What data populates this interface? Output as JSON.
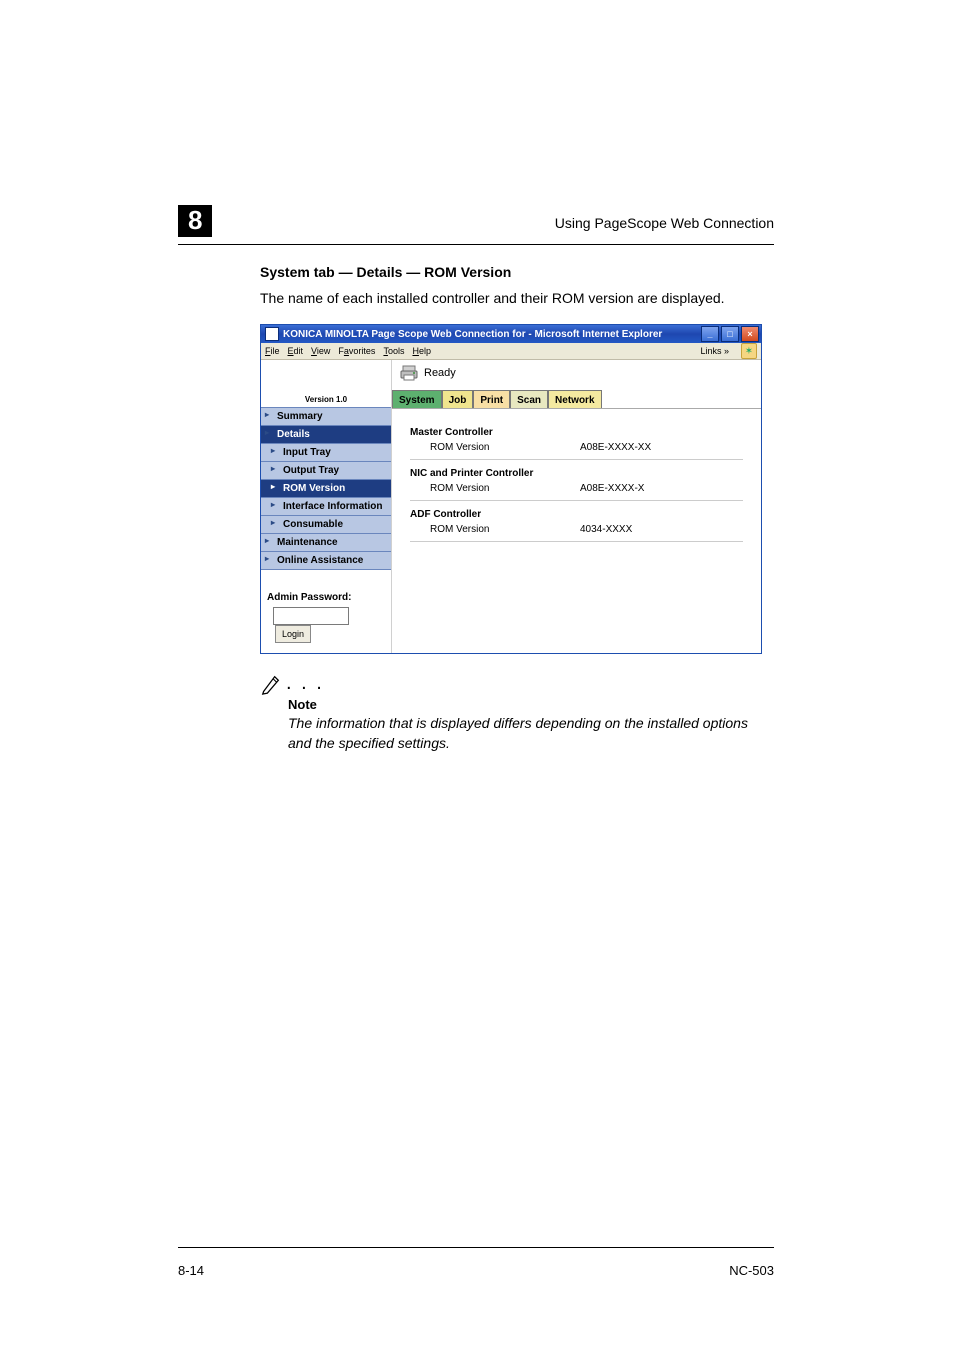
{
  "page": {
    "chapter_number": "8",
    "running_head": "Using PageScope Web Connection",
    "footer_left": "8-14",
    "footer_right": "NC-503"
  },
  "section": {
    "title": "System tab — Details — ROM Version",
    "intro": "The name of each installed controller and their ROM version are displayed."
  },
  "note": {
    "dots": ". . .",
    "label": "Note",
    "body": "The information that is displayed differs depending on the installed options and the specified settings."
  },
  "window": {
    "title": "KONICA MINOLTA Page Scope Web Connection for        - Microsoft Internet Explorer",
    "menu": {
      "file": "File",
      "edit": "Edit",
      "view": "View",
      "favorites": "Favorites",
      "tools": "Tools",
      "help": "Help",
      "links": "Links"
    },
    "logo_version": "Version 1.0",
    "status": "Ready",
    "tabs": {
      "system": "System",
      "job": "Job",
      "print": "Print",
      "scan": "Scan",
      "network": "Network"
    },
    "nav": {
      "summary": "Summary",
      "details": "Details",
      "input_tray": "Input Tray",
      "output_tray": "Output Tray",
      "rom_version": "ROM Version",
      "interface_info": "Interface Information",
      "consumable": "Consumable",
      "maintenance": "Maintenance",
      "online_assist": "Online Assistance"
    },
    "admin": {
      "label": "Admin Password:",
      "login": "Login"
    },
    "groups": {
      "master": {
        "title": "Master Controller",
        "row_label": "ROM Version",
        "row_value": "A08E-XXXX-XX"
      },
      "nic": {
        "title": "NIC and Printer Controller",
        "row_label": "ROM Version",
        "row_value": "A08E-XXXX-X"
      },
      "adf": {
        "title": "ADF Controller",
        "row_label": "ROM Version",
        "row_value": "4034-XXXX"
      }
    }
  }
}
